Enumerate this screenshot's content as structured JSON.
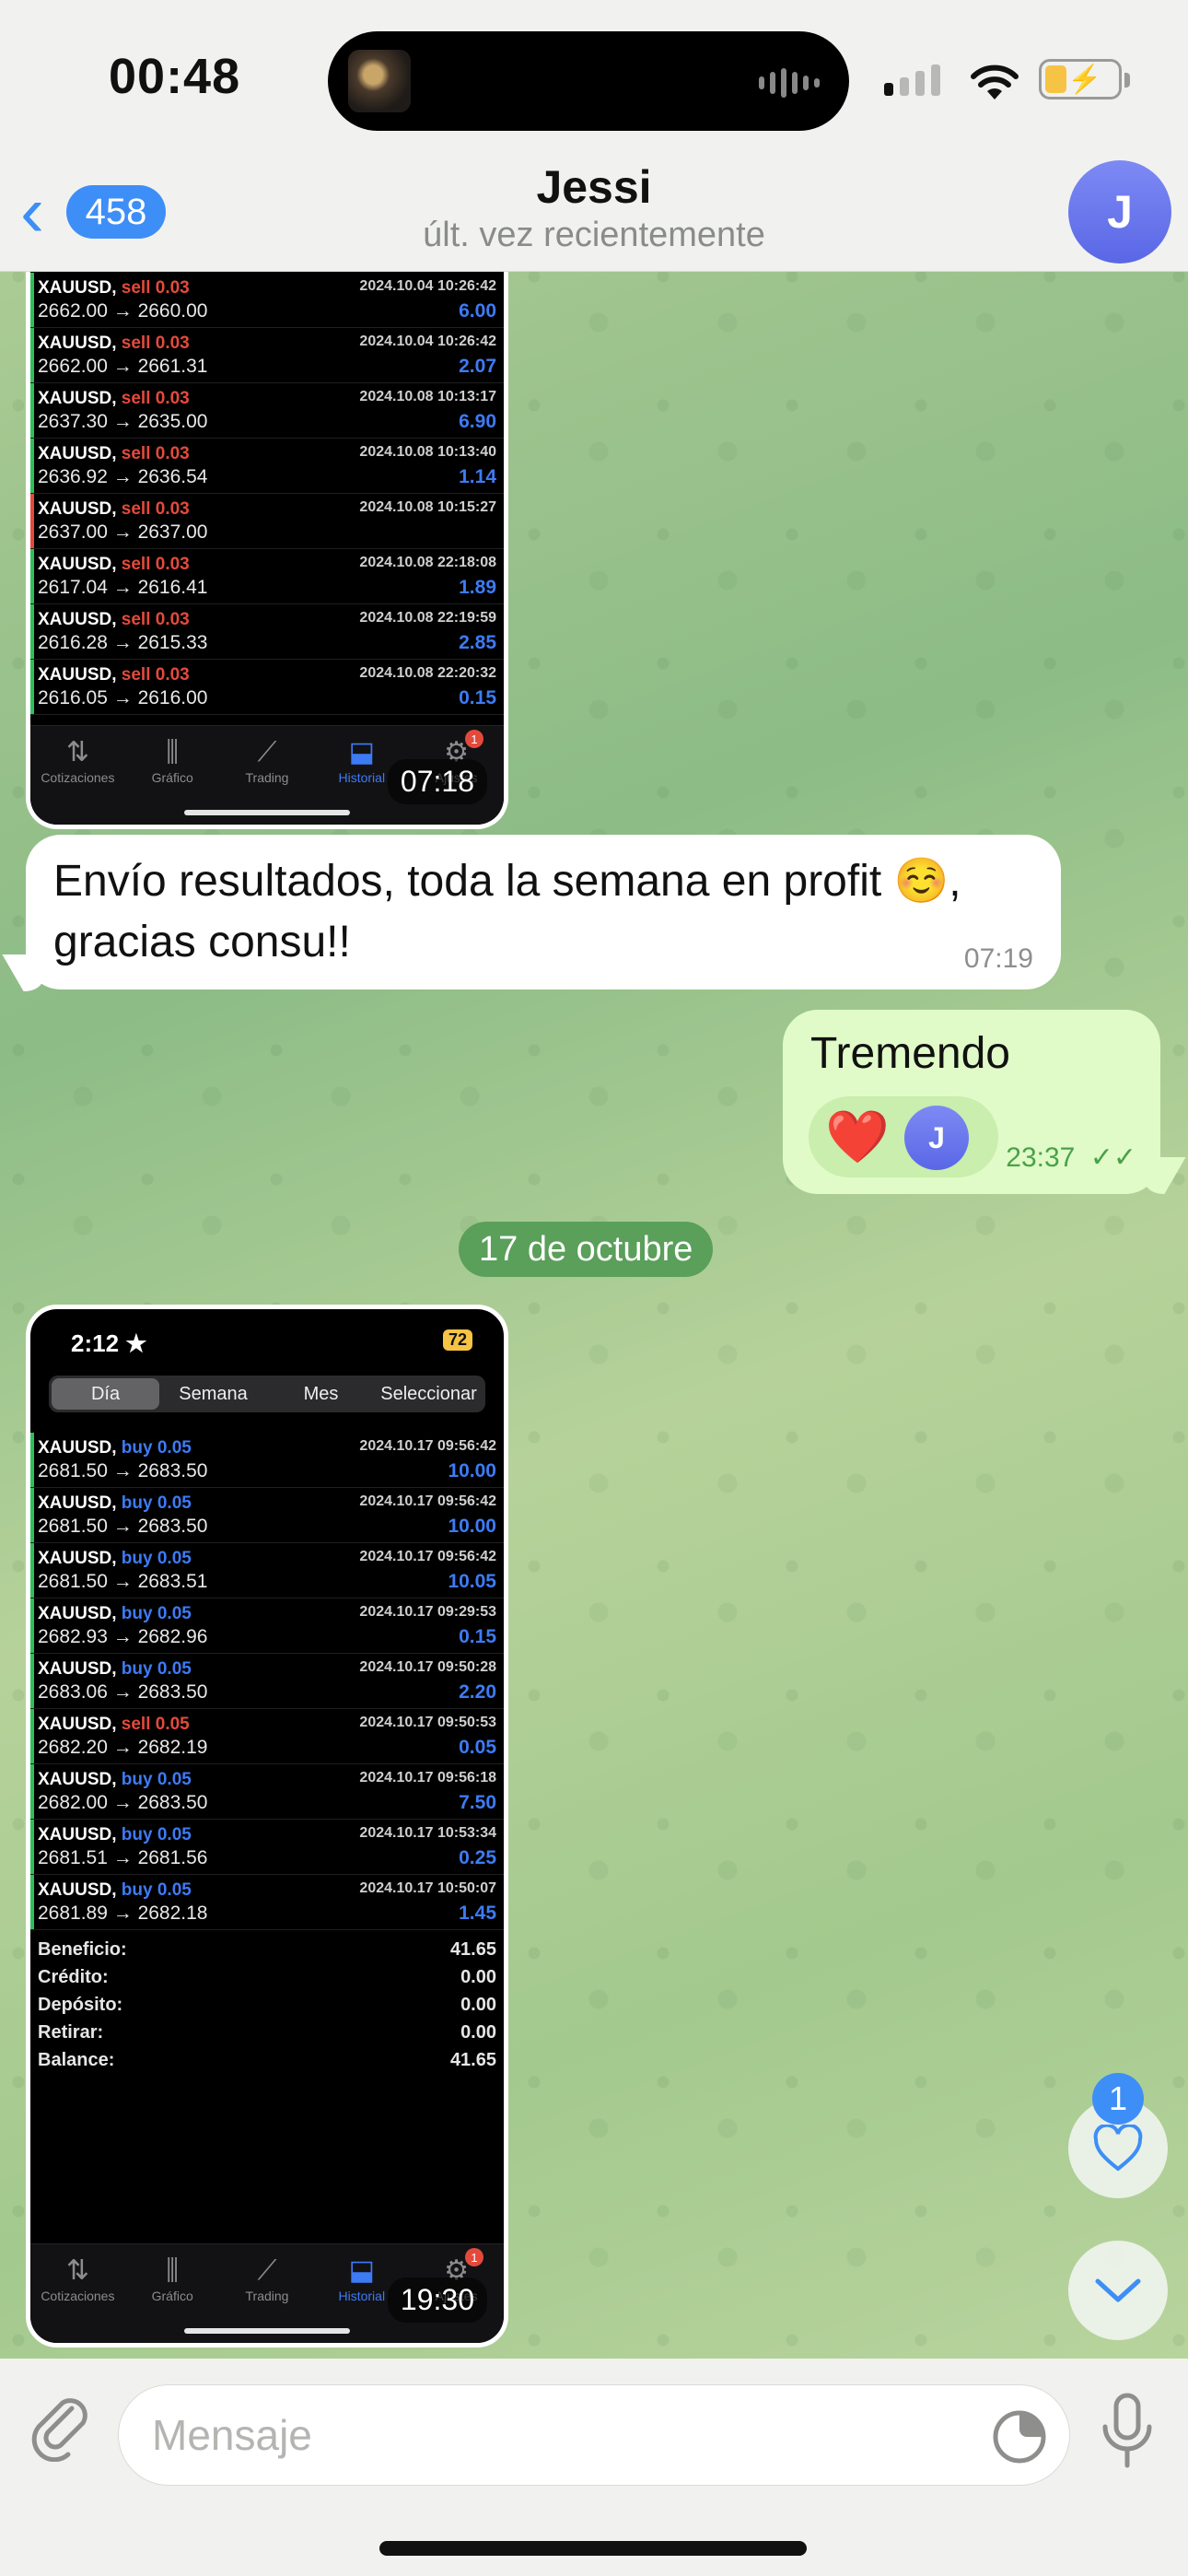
{
  "status_bar": {
    "time": "00:48",
    "battery_level": 0.3
  },
  "header": {
    "back_count": "458",
    "contact_name": "Jessi",
    "contact_status": "últ. vez recientemente",
    "avatar_letter": "J"
  },
  "shot1": {
    "trades": [
      {
        "symbol": "XAUUSD,",
        "dir": "sell 0.03",
        "date": "2024.10.04 10:26:42",
        "prices": "2662.00 → 2660.00",
        "profit": "6.00",
        "side": "sell"
      },
      {
        "symbol": "XAUUSD,",
        "dir": "sell 0.03",
        "date": "2024.10.04 10:26:42",
        "prices": "2662.00 → 2661.31",
        "profit": "2.07",
        "side": "sell"
      },
      {
        "symbol": "XAUUSD,",
        "dir": "sell 0.03",
        "date": "2024.10.08 10:13:17",
        "prices": "2637.30 → 2635.00",
        "profit": "6.90",
        "side": "sell"
      },
      {
        "symbol": "XAUUSD,",
        "dir": "sell 0.03",
        "date": "2024.10.08 10:13:40",
        "prices": "2636.92 → 2636.54",
        "profit": "1.14",
        "side": "sell"
      },
      {
        "symbol": "XAUUSD,",
        "dir": "sell 0.03",
        "date": "2024.10.08 10:15:27",
        "prices": "2637.00 → 2637.00",
        "profit": "",
        "side": "sell-red"
      },
      {
        "symbol": "XAUUSD,",
        "dir": "sell 0.03",
        "date": "2024.10.08 22:18:08",
        "prices": "2617.04 → 2616.41",
        "profit": "1.89",
        "side": "sell"
      },
      {
        "symbol": "XAUUSD,",
        "dir": "sell 0.03",
        "date": "2024.10.08 22:19:59",
        "prices": "2616.28 → 2615.33",
        "profit": "2.85",
        "side": "sell"
      },
      {
        "symbol": "XAUUSD,",
        "dir": "sell 0.03",
        "date": "2024.10.08 22:20:32",
        "prices": "2616.05 → 2616.00",
        "profit": "0.15",
        "side": "sell"
      }
    ],
    "timestamp": "07:18"
  },
  "tabs": [
    "Cotizaciones",
    "Gráfico",
    "Trading",
    "Historial",
    "Ajustes"
  ],
  "notif_count": "1",
  "msg_in": {
    "text": "Envío resultados, toda la semana en profit ☺️, gracias consu!!",
    "time": "07:19"
  },
  "msg_out": {
    "text": "Tremendo",
    "time": "23:37",
    "reaction": "❤️",
    "reactor_letter": "J"
  },
  "date_separator": "17 de octubre",
  "shot2": {
    "status_time": "2:12 ★",
    "battery": "72",
    "segments": [
      "Día",
      "Semana",
      "Mes",
      "Seleccionar"
    ],
    "trades": [
      {
        "symbol": "XAUUSD,",
        "dir": "buy 0.05",
        "date": "2024.10.17 09:56:42",
        "prices": "2681.50 → 2683.50",
        "profit": "10.00",
        "side": "buy"
      },
      {
        "symbol": "XAUUSD,",
        "dir": "buy 0.05",
        "date": "2024.10.17 09:56:42",
        "prices": "2681.50 → 2683.50",
        "profit": "10.00",
        "side": "buy"
      },
      {
        "symbol": "XAUUSD,",
        "dir": "buy 0.05",
        "date": "2024.10.17 09:56:42",
        "prices": "2681.50 → 2683.51",
        "profit": "10.05",
        "side": "buy"
      },
      {
        "symbol": "XAUUSD,",
        "dir": "buy 0.05",
        "date": "2024.10.17 09:29:53",
        "prices": "2682.93 → 2682.96",
        "profit": "0.15",
        "side": "buy"
      },
      {
        "symbol": "XAUUSD,",
        "dir": "buy 0.05",
        "date": "2024.10.17 09:50:28",
        "prices": "2683.06 → 2683.50",
        "profit": "2.20",
        "side": "buy"
      },
      {
        "symbol": "XAUUSD,",
        "dir": "sell 0.05",
        "date": "2024.10.17 09:50:53",
        "prices": "2682.20 → 2682.19",
        "profit": "0.05",
        "side": "sell"
      },
      {
        "symbol": "XAUUSD,",
        "dir": "buy 0.05",
        "date": "2024.10.17 09:56:18",
        "prices": "2682.00 → 2683.50",
        "profit": "7.50",
        "side": "buy"
      },
      {
        "symbol": "XAUUSD,",
        "dir": "buy 0.05",
        "date": "2024.10.17 10:53:34",
        "prices": "2681.51 → 2681.56",
        "profit": "0.25",
        "side": "buy"
      },
      {
        "symbol": "XAUUSD,",
        "dir": "buy 0.05",
        "date": "2024.10.17 10:50:07",
        "prices": "2681.89 → 2682.18",
        "profit": "1.45",
        "side": "buy"
      }
    ],
    "summary": [
      {
        "label": "Beneficio:",
        "value": "41.65"
      },
      {
        "label": "Crédito:",
        "value": "0.00"
      },
      {
        "label": "Depósito:",
        "value": "0.00"
      },
      {
        "label": "Retirar:",
        "value": "0.00"
      },
      {
        "label": "Balance:",
        "value": "41.65"
      }
    ],
    "timestamp": "19:30"
  },
  "reactions_badge": "1",
  "input": {
    "placeholder": "Mensaje"
  },
  "colors": {
    "accent": "#3e8ef7",
    "sell": "#e34a3c",
    "buy": "#3d7bf5",
    "outgoing": "#e0fbc8"
  }
}
